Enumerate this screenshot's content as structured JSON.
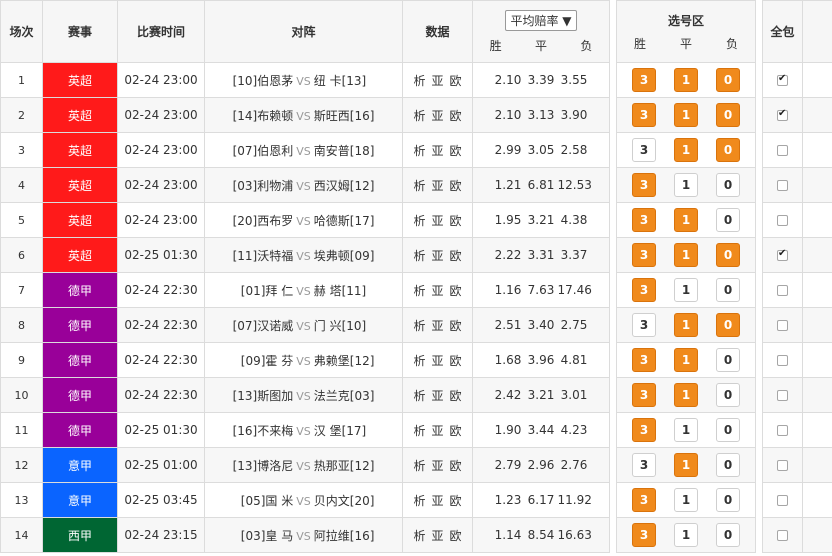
{
  "header": {
    "no": "场次",
    "league": "赛事",
    "time": "比赛时间",
    "match": "对阵",
    "data": "数据",
    "odds_select": "平均赔率",
    "odds_win": "胜",
    "odds_draw": "平",
    "odds_lose": "负",
    "pick_title": "选号区",
    "pick_win": "胜",
    "pick_draw": "平",
    "pick_lose": "负",
    "full": "全包"
  },
  "colors": {
    "英超": "#ff1a1a",
    "德甲": "#990099",
    "意甲": "#0a64ff",
    "西甲": "#006633",
    "accent_pick": "#f08a1c"
  },
  "rows": [
    {
      "no": "1",
      "league": "英超",
      "time": "02-24 23:00",
      "home_rank": "[10]",
      "home": "伯恩茅",
      "vs": "VS",
      "away": "纽 卡",
      "away_rank": "[13]",
      "l1": "析",
      "l2": "亚",
      "l3": "欧",
      "w": "2.10",
      "d": "3.39",
      "l": "3.55",
      "p3": true,
      "p1": true,
      "p0": true,
      "full": true
    },
    {
      "no": "2",
      "league": "英超",
      "time": "02-24 23:00",
      "home_rank": "[14]",
      "home": "布赖顿",
      "vs": "VS",
      "away": "斯旺西",
      "away_rank": "[16]",
      "l1": "析",
      "l2": "亚",
      "l3": "欧",
      "w": "2.10",
      "d": "3.13",
      "l": "3.90",
      "p3": true,
      "p1": true,
      "p0": true,
      "full": true
    },
    {
      "no": "3",
      "league": "英超",
      "time": "02-24 23:00",
      "home_rank": "[07]",
      "home": "伯恩利",
      "vs": "VS",
      "away": "南安普",
      "away_rank": "[18]",
      "l1": "析",
      "l2": "亚",
      "l3": "欧",
      "w": "2.99",
      "d": "3.05",
      "l": "2.58",
      "p3": false,
      "p1": true,
      "p0": true,
      "full": false
    },
    {
      "no": "4",
      "league": "英超",
      "time": "02-24 23:00",
      "home_rank": "[03]",
      "home": "利物浦",
      "vs": "VS",
      "away": "西汉姆",
      "away_rank": "[12]",
      "l1": "析",
      "l2": "亚",
      "l3": "欧",
      "w": "1.21",
      "d": "6.81",
      "l": "12.53",
      "p3": true,
      "p1": false,
      "p0": false,
      "full": false
    },
    {
      "no": "5",
      "league": "英超",
      "time": "02-24 23:00",
      "home_rank": "[20]",
      "home": "西布罗",
      "vs": "VS",
      "away": "哈德斯",
      "away_rank": "[17]",
      "l1": "析",
      "l2": "亚",
      "l3": "欧",
      "w": "1.95",
      "d": "3.21",
      "l": "4.38",
      "p3": true,
      "p1": true,
      "p0": false,
      "full": false
    },
    {
      "no": "6",
      "league": "英超",
      "time": "02-25 01:30",
      "home_rank": "[11]",
      "home": "沃特福",
      "vs": "VS",
      "away": "埃弗顿",
      "away_rank": "[09]",
      "l1": "析",
      "l2": "亚",
      "l3": "欧",
      "w": "2.22",
      "d": "3.31",
      "l": "3.37",
      "p3": true,
      "p1": true,
      "p0": true,
      "full": true
    },
    {
      "no": "7",
      "league": "德甲",
      "time": "02-24 22:30",
      "home_rank": "[01]",
      "home": "拜 仁",
      "vs": "VS",
      "away": "赫 塔",
      "away_rank": "[11]",
      "l1": "析",
      "l2": "亚",
      "l3": "欧",
      "w": "1.16",
      "d": "7.63",
      "l": "17.46",
      "p3": true,
      "p1": false,
      "p0": false,
      "full": false
    },
    {
      "no": "8",
      "league": "德甲",
      "time": "02-24 22:30",
      "home_rank": "[07]",
      "home": "汉诺威",
      "vs": "VS",
      "away": "门 兴",
      "away_rank": "[10]",
      "l1": "析",
      "l2": "亚",
      "l3": "欧",
      "w": "2.51",
      "d": "3.40",
      "l": "2.75",
      "p3": false,
      "p1": true,
      "p0": true,
      "full": false
    },
    {
      "no": "9",
      "league": "德甲",
      "time": "02-24 22:30",
      "home_rank": "[09]",
      "home": "霍 芬",
      "vs": "VS",
      "away": "弗赖堡",
      "away_rank": "[12]",
      "l1": "析",
      "l2": "亚",
      "l3": "欧",
      "w": "1.68",
      "d": "3.96",
      "l": "4.81",
      "p3": true,
      "p1": true,
      "p0": false,
      "full": false
    },
    {
      "no": "10",
      "league": "德甲",
      "time": "02-24 22:30",
      "home_rank": "[13]",
      "home": "斯图加",
      "vs": "VS",
      "away": "法兰克",
      "away_rank": "[03]",
      "l1": "析",
      "l2": "亚",
      "l3": "欧",
      "w": "2.42",
      "d": "3.21",
      "l": "3.01",
      "p3": true,
      "p1": true,
      "p0": false,
      "full": false
    },
    {
      "no": "11",
      "league": "德甲",
      "time": "02-25 01:30",
      "home_rank": "[16]",
      "home": "不来梅",
      "vs": "VS",
      "away": "汉 堡",
      "away_rank": "[17]",
      "l1": "析",
      "l2": "亚",
      "l3": "欧",
      "w": "1.90",
      "d": "3.44",
      "l": "4.23",
      "p3": true,
      "p1": false,
      "p0": false,
      "full": false
    },
    {
      "no": "12",
      "league": "意甲",
      "time": "02-25 01:00",
      "home_rank": "[13]",
      "home": "博洛尼",
      "vs": "VS",
      "away": "热那亚",
      "away_rank": "[12]",
      "l1": "析",
      "l2": "亚",
      "l3": "欧",
      "w": "2.79",
      "d": "2.96",
      "l": "2.76",
      "p3": false,
      "p1": true,
      "p0": false,
      "full": false
    },
    {
      "no": "13",
      "league": "意甲",
      "time": "02-25 03:45",
      "home_rank": "[05]",
      "home": "国 米",
      "vs": "VS",
      "away": "贝内文",
      "away_rank": "[20]",
      "l1": "析",
      "l2": "亚",
      "l3": "欧",
      "w": "1.23",
      "d": "6.17",
      "l": "11.92",
      "p3": true,
      "p1": false,
      "p0": false,
      "full": false
    },
    {
      "no": "14",
      "league": "西甲",
      "time": "02-24 23:15",
      "home_rank": "[03]",
      "home": "皇 马",
      "vs": "VS",
      "away": "阿拉维",
      "away_rank": "[16]",
      "l1": "析",
      "l2": "亚",
      "l3": "欧",
      "w": "1.14",
      "d": "8.54",
      "l": "16.63",
      "p3": true,
      "p1": false,
      "p0": false,
      "full": false
    }
  ]
}
